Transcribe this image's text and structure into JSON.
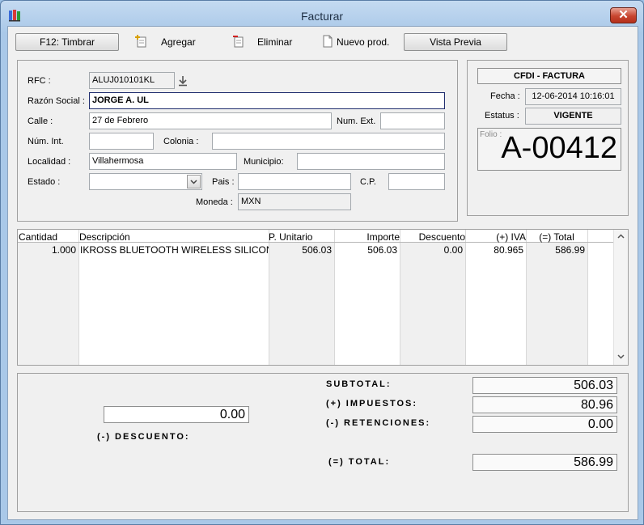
{
  "window": {
    "title": "Facturar",
    "close_label": "✕"
  },
  "toolbar": {
    "timbrar_label": "F12:  Timbrar",
    "agregar_label": "Agregar",
    "eliminar_label": "Eliminar",
    "nuevo_label": "Nuevo prod.",
    "vista_previa_label": "Vista Previa"
  },
  "customer": {
    "rfc_label": "RFC :",
    "rfc_value": "ALUJ010101KL",
    "razon_label": "Razón Social :",
    "razon_value": "JORGE A. UL",
    "calle_label": "Calle :",
    "calle_value": "27 de Febrero",
    "num_ext_label": "Num. Ext.",
    "num_ext_value": "",
    "num_int_label": "Núm. Int.",
    "num_int_value": "",
    "colonia_label": "Colonia :",
    "colonia_value": "",
    "localidad_label": "Localidad :",
    "localidad_value": "Villahermosa",
    "municipio_label": "Municipio:",
    "municipio_value": "",
    "estado_label": "Estado :",
    "estado_value": "",
    "pais_label": "Pais :",
    "pais_value": "",
    "cp_label": "C.P.",
    "cp_value": "",
    "moneda_label": "Moneda :",
    "moneda_value": "MXN"
  },
  "cfdi": {
    "header": "CFDI - FACTURA",
    "fecha_label": "Fecha :",
    "fecha_value": "12-06-2014 10:16:01",
    "estatus_label": "Estatus :",
    "estatus_value": "VIGENTE",
    "folio_label": "Folio :",
    "folio_value": "A-00412"
  },
  "grid": {
    "headers": {
      "cantidad": "Cantidad",
      "descripcion": "Descripción",
      "p_unitario": "P. Unitario",
      "importe": "Importe",
      "descuento": "Descuento",
      "iva": "(+) IVA",
      "total": "(=) Total"
    },
    "rows": [
      {
        "cantidad": "1.000",
        "descripcion": "IKROSS BLUETOOTH WIRELESS SILICONE",
        "p_unitario": "506.03",
        "importe": "506.03",
        "descuento": "0.00",
        "iva": "80.965",
        "total": "586.99"
      }
    ]
  },
  "totals": {
    "subtotal_label": "SUBTOTAL:",
    "subtotal_value": "506.03",
    "impuestos_label": "(+) IMPUESTOS:",
    "impuestos_value": "80.96",
    "retenciones_label": "(-) RETENCIONES:",
    "retenciones_value": "0.00",
    "total_label": "(=) TOTAL:",
    "total_value": "586.99",
    "descuento_label": "(-) DESCUENTO:",
    "descuento_value": "0.00"
  },
  "icons": {
    "app": "app-icon",
    "agregar": "add-document-icon",
    "eliminar": "delete-document-icon",
    "nuevo": "new-document-icon",
    "rfc_lookup": "download-arrow-icon",
    "dropdown": "chevron-down-icon",
    "scroll_up": "chevron-up-icon",
    "scroll_down": "chevron-down-icon"
  }
}
